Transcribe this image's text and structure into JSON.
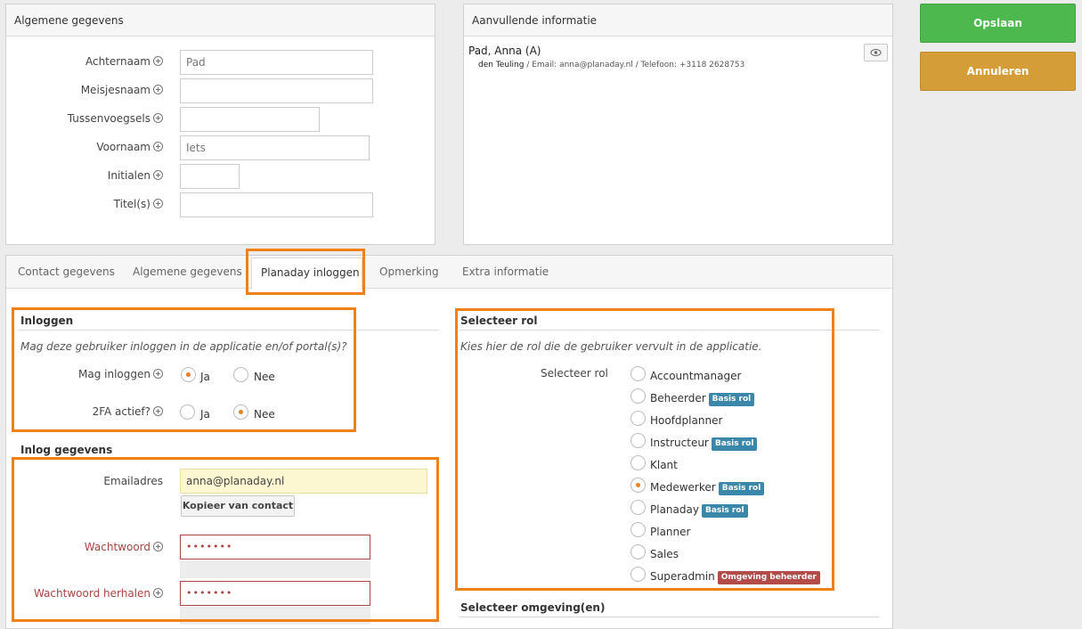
{
  "general_panel": {
    "title": "Algemene gegevens",
    "fields": [
      {
        "label": "Achternaam",
        "value": "Pad"
      },
      {
        "label": "Meisjesnaam",
        "value": ""
      },
      {
        "label": "Tussenvoegsels",
        "value": ""
      },
      {
        "label": "Voornaam",
        "value": "Iets"
      },
      {
        "label": "Initialen",
        "value": ""
      },
      {
        "label": "Titel(s)",
        "value": ""
      }
    ]
  },
  "extra_panel": {
    "title": "Aanvullende informatie",
    "person_name": "Pad, Anna (A)",
    "person_city": "den Teuling",
    "person_details": " / Email: anna@planaday.nl / Telefoon: +3118 2628753",
    "eye_icon": "eye-icon"
  },
  "actions": {
    "save_label": "Opslaan",
    "cancel_label": "Annuleren",
    "save_color": "#4db84d",
    "cancel_color": "#d59d38"
  },
  "tabs": [
    {
      "label": "Contact gegevens",
      "active": false
    },
    {
      "label": "Algemene gegevens",
      "active": false
    },
    {
      "label": "Planaday inloggen",
      "active": true
    },
    {
      "label": "Opmerking",
      "active": false
    },
    {
      "label": "Extra informatie",
      "active": false
    }
  ],
  "login": {
    "title": "Inloggen",
    "question": "Mag deze gebruiker inloggen in de applicatie en/of portal(s)?",
    "may_login": {
      "label": "Mag inloggen",
      "options": [
        "Ja",
        "Nee"
      ],
      "selected": "Ja"
    },
    "twofa": {
      "label": "2FA actief?",
      "options": [
        "Ja",
        "Nee"
      ],
      "selected": "Nee"
    }
  },
  "credentials": {
    "title": "Inlog gegevens",
    "email_label": "Emailadres",
    "email_value": "anna@planaday.nl",
    "copy_button": "Kopieer van contact",
    "password_label": "Wachtwoord",
    "password_value": "•••••••",
    "password_repeat_label": "Wachtwoord herhalen",
    "password_repeat_value": "•••••••"
  },
  "roles": {
    "title": "Selecteer rol",
    "description": "Kies hier de rol die de gebruiker vervult in de applicatie.",
    "field_label": "Selecteer rol",
    "items": [
      {
        "label": "Accountmanager",
        "badge": "",
        "selected": false
      },
      {
        "label": "Beheerder",
        "badge": "Basis rol",
        "selected": false
      },
      {
        "label": "Hoofdplanner",
        "badge": "",
        "selected": false
      },
      {
        "label": "Instructeur",
        "badge": "Basis rol",
        "selected": false
      },
      {
        "label": "Klant",
        "badge": "",
        "selected": false
      },
      {
        "label": "Medewerker",
        "badge": "Basis rol",
        "selected": true
      },
      {
        "label": "Planaday",
        "badge": "Basis rol",
        "selected": false
      },
      {
        "label": "Planner",
        "badge": "",
        "selected": false
      },
      {
        "label": "Sales",
        "badge": "",
        "selected": false
      },
      {
        "label": "Superadmin",
        "badge": "Omgeving beheerder",
        "selected": false
      }
    ],
    "badge_colors": {
      "Basis rol": "#3b87aa",
      "Omgeving beheerder": "#b34b48"
    }
  },
  "environment": {
    "title": "Selecteer omgeving(en)"
  },
  "highlight_color": "#f28019"
}
